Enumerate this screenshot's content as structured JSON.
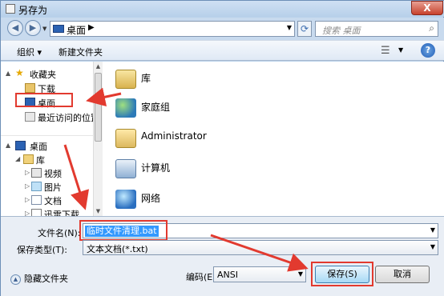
{
  "window": {
    "title": "另存为",
    "close_glyph": "X"
  },
  "address": {
    "path": "桌面",
    "search_placeholder": "搜索 桌面"
  },
  "toolbar": {
    "organize": "组织 ▾",
    "new_folder": "新建文件夹",
    "help": "?"
  },
  "nav": {
    "favorites": "收藏夹",
    "downloads": "下载",
    "desktop_fav": "桌面",
    "recent": "最近访问的位置",
    "desktop_root": "桌面",
    "library": "库",
    "videos": "视频",
    "pictures": "图片",
    "documents": "文档",
    "music": "迅雷下载"
  },
  "content": {
    "items": [
      "库",
      "家庭组",
      "Administrator",
      "计算机",
      "网络"
    ]
  },
  "form": {
    "filename_label": "文件名(N):",
    "filename_value": "临时文件清理.bat",
    "filetype_label": "保存类型(T):",
    "filetype_value": "文本文档(*.txt)",
    "hide_folders": "隐藏文件夹",
    "encoding_label": "编码(E):",
    "encoding_value": "ANSI",
    "save": "保存(S)",
    "cancel": "取消"
  },
  "colors": {
    "annotation": "#e23a2f",
    "selection": "#3399ff"
  }
}
